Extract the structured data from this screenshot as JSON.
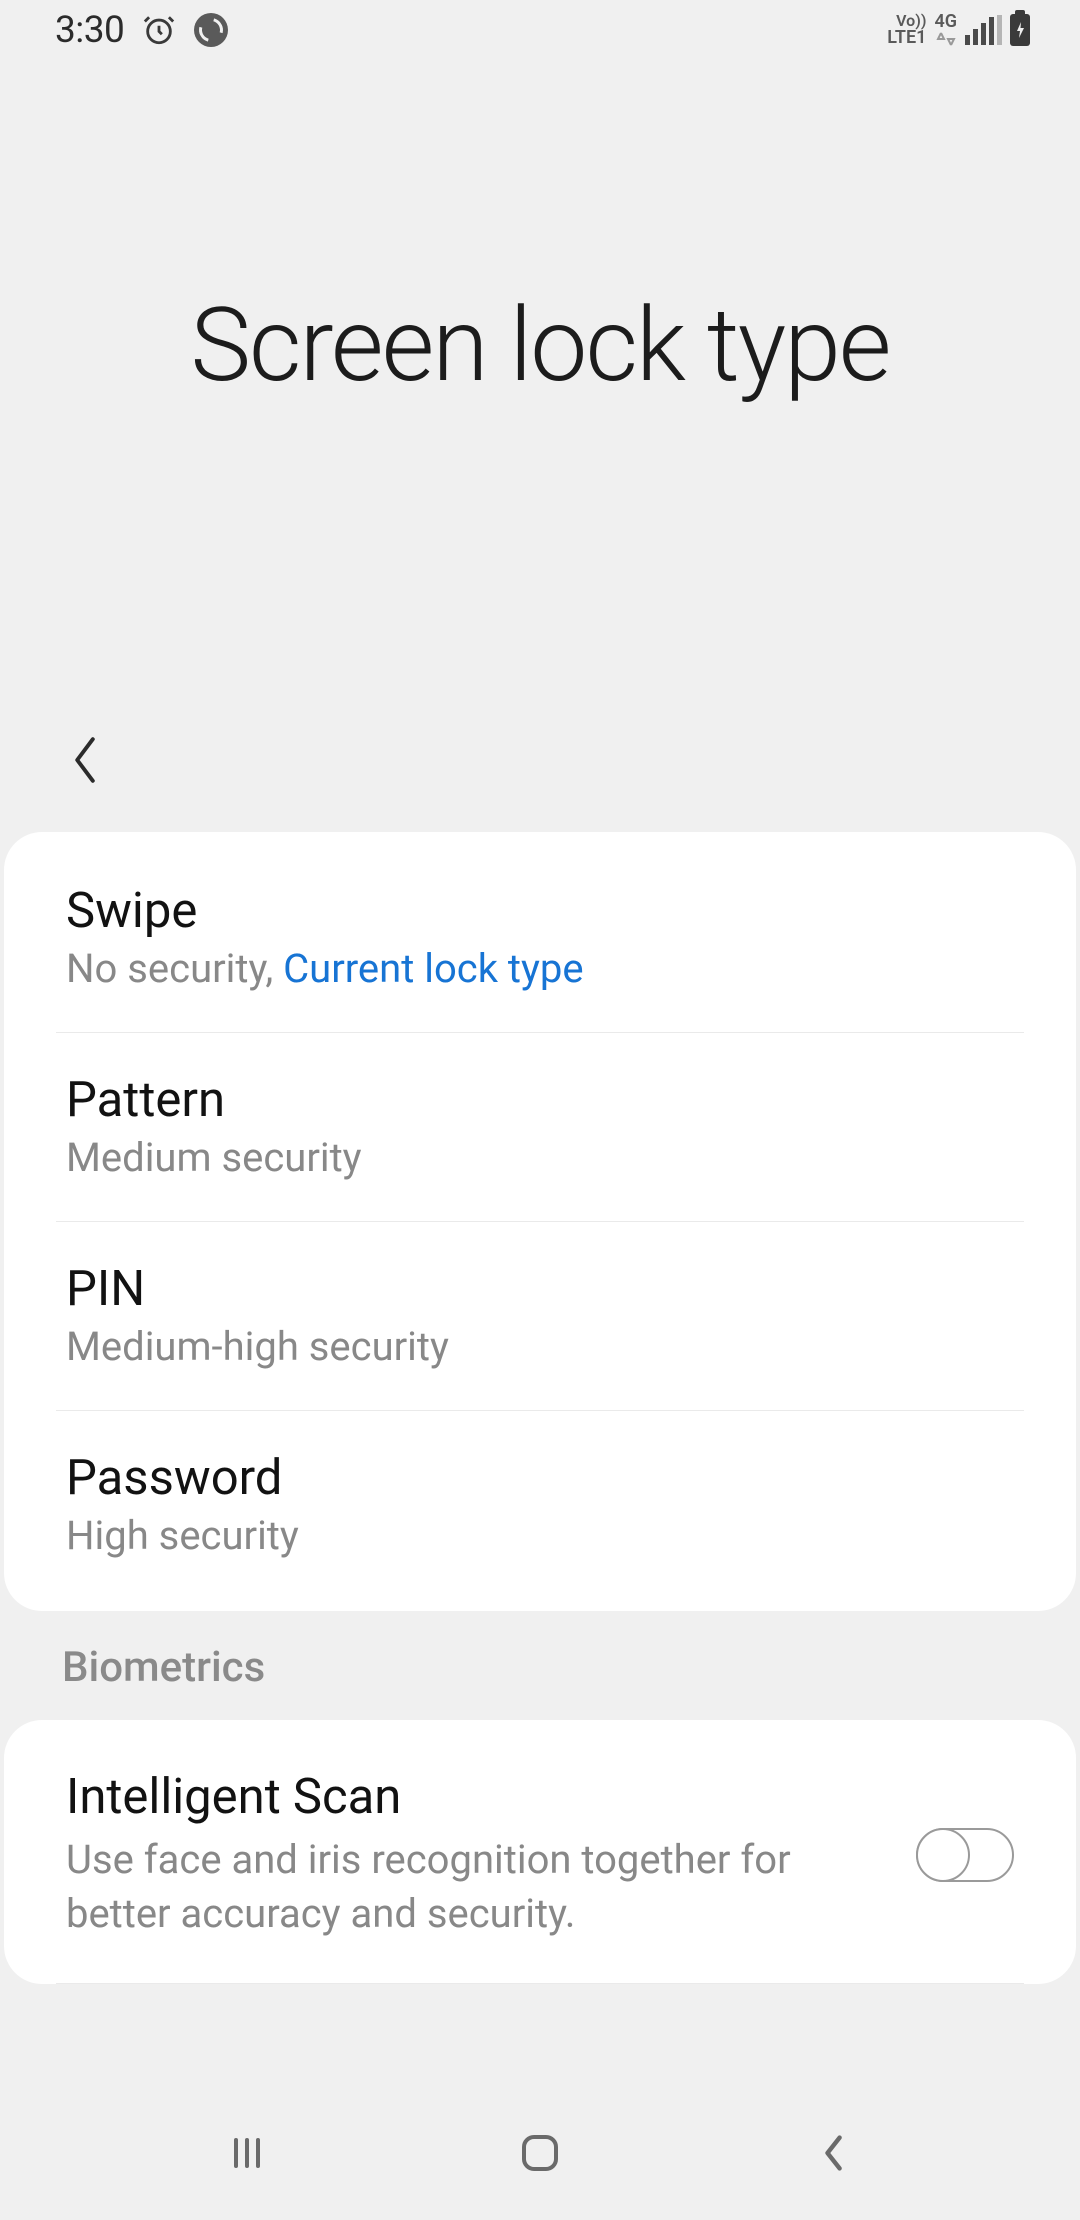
{
  "status": {
    "time": "3:30",
    "lte_top": "Vo))",
    "lte_bottom": "LTE1",
    "net": "4G"
  },
  "page": {
    "title": "Screen lock type"
  },
  "lock_types": [
    {
      "title": "Swipe",
      "sub_prefix": "No security, ",
      "sub_highlight": "Current lock type"
    },
    {
      "title": "Pattern",
      "sub_prefix": "Medium security",
      "sub_highlight": ""
    },
    {
      "title": "PIN",
      "sub_prefix": "Medium-high security",
      "sub_highlight": ""
    },
    {
      "title": "Password",
      "sub_prefix": "High security",
      "sub_highlight": ""
    }
  ],
  "biometrics": {
    "header": "Biometrics",
    "items": [
      {
        "title": "Intelligent Scan",
        "sub": "Use face and iris recognition together for better accuracy and security.",
        "enabled": false
      }
    ]
  }
}
